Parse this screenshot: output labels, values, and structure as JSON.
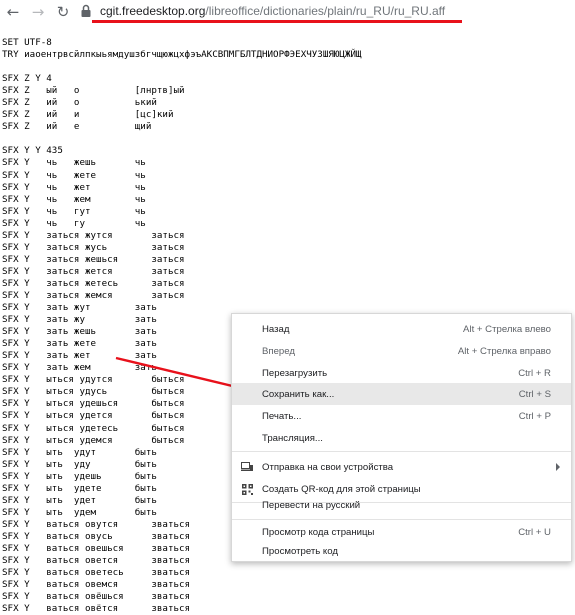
{
  "toolbar": {
    "url_domain": "cgit.freedesktop.org",
    "url_path": "/libreoffice/dictionaries/plain/ru_RU/ru_RU.aff",
    "back_glyph": "←",
    "forward_glyph": "→",
    "reload_glyph": "↻",
    "icons": {
      "back": "back-arrow-icon",
      "forward": "forward-arrow-icon",
      "reload": "reload-icon",
      "lock": "lock-icon"
    }
  },
  "source_lines": [
    "SET UTF-8",
    "TRY иаоентрвсйлпкыьямдушзбгчщюжцхфэъАКСВПМГБЛТДНИОРФЭЕХЧУЗШЯЮЦЖЙЩ",
    "",
    "SFX Z Y 4",
    "SFX Z   ый   о          [лнртв]ый",
    "SFX Z   ий   о          ький",
    "SFX Z   ий   и          [цс]кий",
    "SFX Z   ий   е          щий",
    "",
    "SFX Y Y 435",
    "SFX Y   чь   жешь       чь",
    "SFX Y   чь   жете       чь",
    "SFX Y   чь   жет        чь",
    "SFX Y   чь   жем        чь",
    "SFX Y   чь   гут        чь",
    "SFX Y   чь   гу         чь",
    "SFX Y   заться жутся       заться",
    "SFX Y   заться жусь        заться",
    "SFX Y   заться жешься      заться",
    "SFX Y   заться жется       заться",
    "SFX Y   заться жетесь      заться",
    "SFX Y   заться жемся       заться",
    "SFX Y   зать жут        зать",
    "SFX Y   зать жу         зать",
    "SFX Y   зать жешь       зать",
    "SFX Y   зать жете       зать",
    "SFX Y   зать жет        зать",
    "SFX Y   зать жем        зать",
    "SFX Y   ыться удутся       быться",
    "SFX Y   ыться удусь        быться",
    "SFX Y   ыться удешься      быться",
    "SFX Y   ыться удется       быться",
    "SFX Y   ыться удетесь      быться",
    "SFX Y   ыться удемся       быться",
    "SFX Y   ыть  удут       быть",
    "SFX Y   ыть  уду        быть",
    "SFX Y   ыть  удешь      быть",
    "SFX Y   ыть  удете      быть",
    "SFX Y   ыть  удет       быть",
    "SFX Y   ыть  удем       быть",
    "SFX Y   ваться овутся      зваться",
    "SFX Y   ваться овусь       зваться",
    "SFX Y   ваться овешься     зваться",
    "SFX Y   ваться овется      зваться",
    "SFX Y   ваться оветесь     зваться",
    "SFX Y   ваться овемся      зваться",
    "SFX Y   ваться овёшься     зваться",
    "SFX Y   ваться овётся      зваться"
  ],
  "context_menu": {
    "items": [
      {
        "label": "Назад",
        "shortcut": "Alt + Стрелка влево"
      },
      {
        "label": "Вперед",
        "shortcut": "Alt + Стрелка вправо"
      },
      {
        "label": "Перезагрузить",
        "shortcut": "Ctrl + R"
      },
      {
        "label": "Сохранить как...",
        "shortcut": "Ctrl + S"
      },
      {
        "label": "Печать...",
        "shortcut": "Ctrl + P"
      },
      {
        "label": "Трансляция...",
        "shortcut": ""
      },
      {
        "label": "Отправка на свои устройства",
        "shortcut": ""
      },
      {
        "label": "Создать QR-код для этой страницы",
        "shortcut": ""
      },
      {
        "label": "Перевести на русский",
        "shortcut": ""
      },
      {
        "label": "Просмотр кода страницы",
        "shortcut": "Ctrl + U"
      },
      {
        "label": "Просмотреть код",
        "shortcut": ""
      }
    ],
    "highlighted": "Сохранить как...",
    "icons": {
      "send": "devices-icon",
      "qr": "qr-code-icon",
      "submenu": "submenu-arrow-icon"
    }
  },
  "colors": {
    "annotation": "#e8111b",
    "menu_highlight": "#e8e8e8"
  }
}
